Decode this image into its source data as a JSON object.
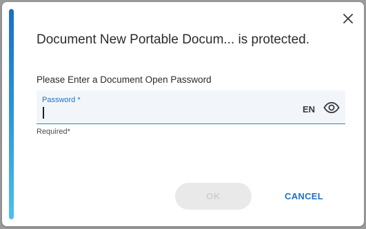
{
  "dialog": {
    "title": "Document New Portable Docum... is protected.",
    "prompt": "Please Enter a Document Open Password",
    "close_icon": "close-icon"
  },
  "password_field": {
    "label": "Password *",
    "value": "",
    "language": "EN",
    "visibility_icon": "eye-icon",
    "helper": "Required*"
  },
  "buttons": {
    "ok_label": "OK",
    "ok_enabled": false,
    "cancel_label": "CANCEL"
  },
  "colors": {
    "accent": "#1a73c8",
    "accent_bar_top": "#1a6fc0",
    "accent_bar_bottom": "#4cc0ec",
    "disabled_bg": "#e9e9e9",
    "disabled_text": "#cfcfcf"
  }
}
